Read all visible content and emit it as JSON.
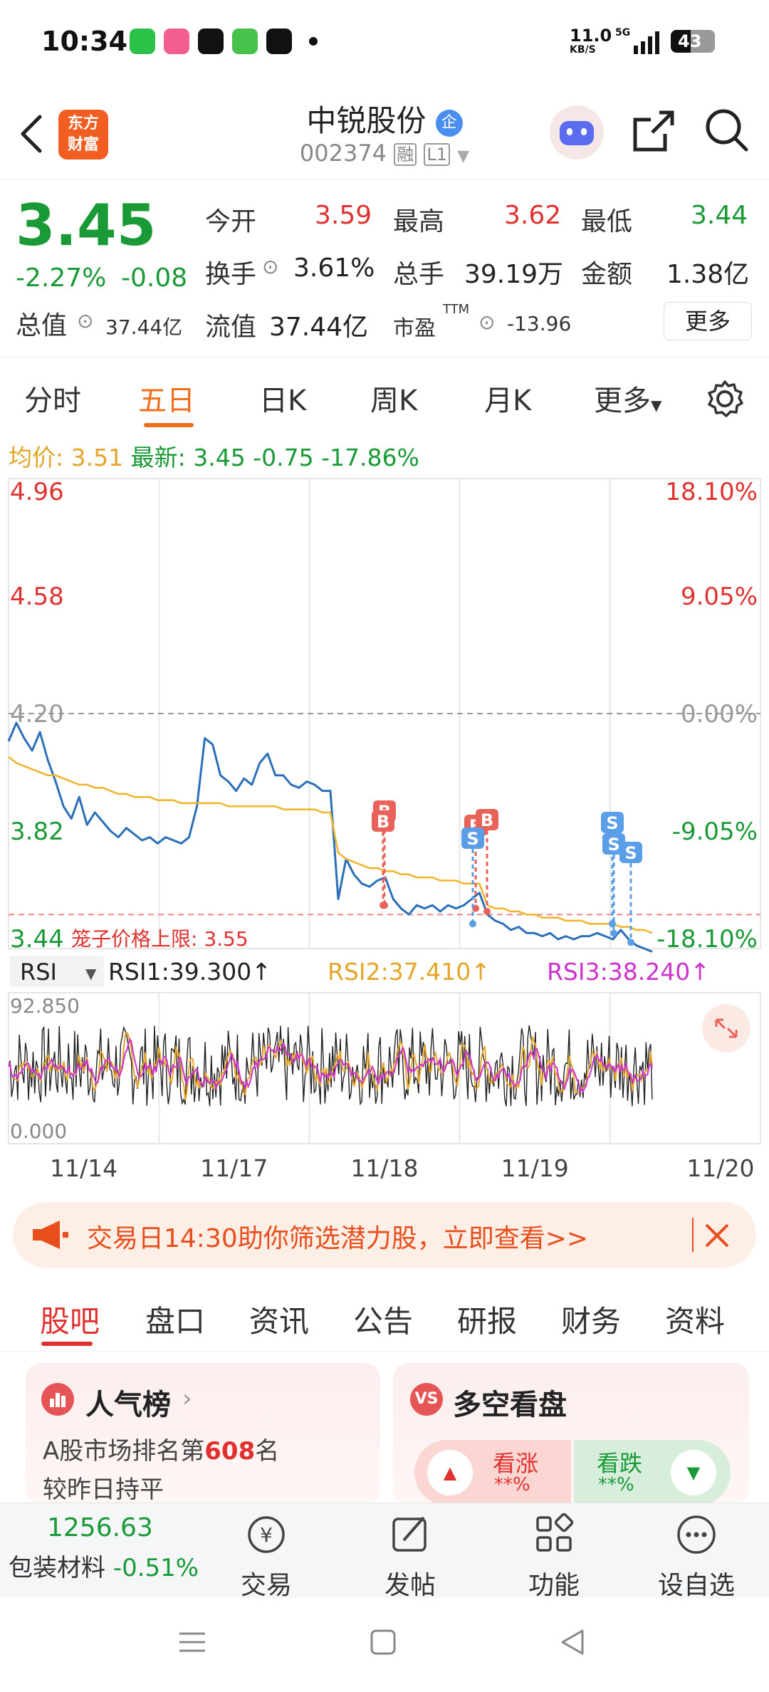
{
  "status_bar": {
    "time": "10:34",
    "net_speed": "11.0",
    "net_unit": "KB/S",
    "battery": "43",
    "icons": [
      "wechat-icon",
      "bilibili-icon",
      "dewu-icon",
      "message-icon",
      "tiktok-icon",
      "dot-icon"
    ]
  },
  "header": {
    "logo_line1": "东方",
    "logo_line2": "财富",
    "stock_name": "中锐股份",
    "badge": "企",
    "stock_code": "002374",
    "tag_rong": "融",
    "tag_level": "L1"
  },
  "quote": {
    "price": "3.45",
    "change_pct": "-2.27%",
    "change": "-0.08",
    "open_label": "今开",
    "open": "3.59",
    "high_label": "最高",
    "high": "3.62",
    "low_label": "最低",
    "low": "3.44",
    "turnover_label": "换手",
    "turnover": "3.61%",
    "volume_label": "总手",
    "volume": "39.19万",
    "amount_label": "金额",
    "amount": "1.38亿",
    "mktcap_label": "总值",
    "mktcap": "37.44亿",
    "float_label": "流值",
    "float_cap": "37.44亿",
    "pe_label": "市盈",
    "pe_sup": "TTM",
    "pe": "-13.96",
    "more": "更多"
  },
  "chart_tabs": [
    "分时",
    "五日",
    "日K",
    "周K",
    "月K",
    "更多"
  ],
  "avg_row": {
    "avg_label": "均价:",
    "avg": "3.51",
    "latest_label": "最新:",
    "latest": "3.45",
    "chg": "-0.75",
    "chg_pct": "-17.86%"
  },
  "chart_data": [
    {
      "type": "line",
      "title": "五日分时",
      "y_ticks_left": [
        "4.96",
        "4.58",
        "4.20",
        "3.82",
        "3.44"
      ],
      "y_ticks_right": [
        "18.10%",
        "9.05%",
        "0.00%",
        "-9.05%",
        "-18.10%"
      ],
      "ylim": [
        3.44,
        4.96
      ],
      "prev_close": 4.2,
      "cage_limit_label": "笼子价格上限:",
      "cage_limit": "3.55",
      "x_ticks": [
        "11/14",
        "11/17",
        "11/18",
        "11/19",
        "11/20"
      ],
      "series": [
        {
          "name": "price",
          "color": "#2a6fb8",
          "values": [
            4.11,
            4.17,
            4.12,
            4.08,
            4.14,
            4.05,
            3.98,
            3.9,
            3.86,
            3.93,
            3.84,
            3.88,
            3.85,
            3.82,
            3.8,
            3.83,
            3.81,
            3.79,
            3.8,
            3.78,
            3.8,
            3.79,
            3.78,
            3.8,
            3.9,
            4.12,
            4.1,
            4.0,
            3.98,
            3.95,
            3.99,
            3.97,
            4.04,
            4.07,
            4.0,
            4.0,
            3.97,
            3.96,
            3.98,
            3.97,
            3.95,
            3.95,
            3.6,
            3.73,
            3.68,
            3.65,
            3.64,
            3.66,
            3.67,
            3.6,
            3.57,
            3.55,
            3.58,
            3.57,
            3.58,
            3.56,
            3.58,
            3.57,
            3.58,
            3.6,
            3.62,
            3.55,
            3.53,
            3.52,
            3.5,
            3.51,
            3.49,
            3.49,
            3.48,
            3.49,
            3.47,
            3.48,
            3.47,
            3.48,
            3.48,
            3.49,
            3.48,
            3.47,
            3.5,
            3.47,
            3.45,
            3.44,
            3.43
          ]
        },
        {
          "name": "avg",
          "color": "#f0b429",
          "values": [
            4.06,
            4.04,
            4.03,
            4.02,
            4.01,
            4.0,
            4.0,
            3.99,
            3.98,
            3.97,
            3.97,
            3.96,
            3.96,
            3.95,
            3.94,
            3.94,
            3.93,
            3.93,
            3.93,
            3.92,
            3.92,
            3.92,
            3.91,
            3.91,
            3.91,
            3.91,
            3.91,
            3.91,
            3.9,
            3.9,
            3.9,
            3.9,
            3.9,
            3.9,
            3.9,
            3.89,
            3.89,
            3.89,
            3.89,
            3.89,
            3.88,
            3.88,
            3.75,
            3.73,
            3.72,
            3.71,
            3.7,
            3.7,
            3.69,
            3.69,
            3.68,
            3.68,
            3.67,
            3.67,
            3.67,
            3.66,
            3.66,
            3.66,
            3.65,
            3.65,
            3.65,
            3.58,
            3.57,
            3.57,
            3.56,
            3.56,
            3.55,
            3.55,
            3.54,
            3.54,
            3.54,
            3.53,
            3.53,
            3.53,
            3.52,
            3.52,
            3.52,
            3.52,
            3.51,
            3.51,
            3.5,
            3.5,
            3.49
          ]
        }
      ],
      "markers": [
        {
          "label": "B",
          "type": "buy",
          "price": 3.58
        },
        {
          "label": "B",
          "type": "buy",
          "price": 3.58
        },
        {
          "label": "B",
          "type": "buy",
          "price": 3.57
        },
        {
          "label": "B",
          "type": "buy",
          "price": 3.56
        },
        {
          "label": "S",
          "type": "sell",
          "price": 3.52
        },
        {
          "label": "S",
          "type": "sell",
          "price": 3.52
        },
        {
          "label": "S",
          "type": "sell",
          "price": 3.49
        },
        {
          "label": "S",
          "type": "sell",
          "price": 3.46
        }
      ]
    },
    {
      "type": "line",
      "title": "RSI",
      "ylim": [
        0,
        92.85
      ],
      "y_ticks": [
        "92.850",
        "0.000"
      ],
      "selector": "RSI",
      "series": [
        {
          "name": "RSI1",
          "label": "RSI1:39.300↑",
          "color": "#222222"
        },
        {
          "name": "RSI2",
          "label": "RSI2:37.410↑",
          "color": "#f0b429"
        },
        {
          "name": "RSI3",
          "label": "RSI3:38.240↑",
          "color": "#cc33cc"
        }
      ]
    }
  ],
  "banner": {
    "text": "交易日14:30助你筛选潜力股，立即查看>>",
    "close": "×"
  },
  "info_tabs": [
    "股吧",
    "盘口",
    "资讯",
    "公告",
    "研报",
    "财务",
    "资料"
  ],
  "popularity": {
    "title": "人气榜",
    "rank_prefix": "A股市场排名第",
    "rank": "608",
    "rank_suffix": "名",
    "compare": "较昨日持平"
  },
  "bullbear": {
    "title": "多空看盘",
    "up_label": "看涨",
    "up_val": "**%",
    "down_label": "看跌",
    "down_val": "**%"
  },
  "bottom_nav": {
    "sector_value": "1256.63",
    "sector_name": "包装材料",
    "sector_chg": "-0.51%",
    "items": [
      "交易",
      "发帖",
      "功能",
      "设自选"
    ]
  },
  "colors": {
    "up": "#e0312f",
    "down": "#1a9a37",
    "accent": "#f06d1b",
    "price_line": "#2a6fb8",
    "avg_line": "#f0b429"
  }
}
